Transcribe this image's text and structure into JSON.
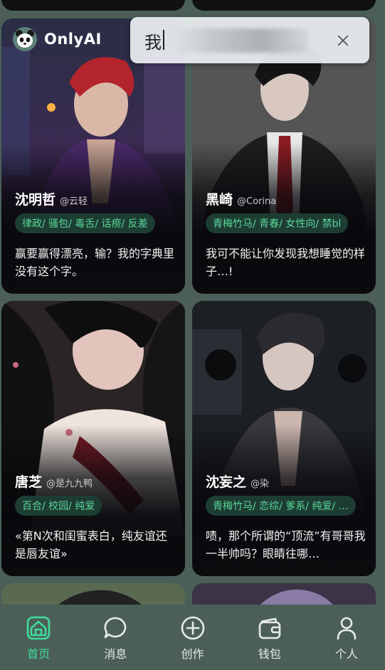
{
  "app": {
    "name": "OnlyAI",
    "logo_icon": "panda-icon"
  },
  "search": {
    "query": "我",
    "clear_icon": "close-icon"
  },
  "cards": [
    {
      "name": "沈明哲",
      "author": "@云轻",
      "tags": "律政/ 骚包/ 毒舌/ 话痨/ 反差",
      "desc": "赢要赢得漂亮，输？我的字典里没有这个字。"
    },
    {
      "name": "黑崎",
      "author": "@Corina",
      "tags": "青梅竹马/ 青春/ 女性向/ 禁bl",
      "desc": "我可不能让你发现我想睡觉的样子…!"
    },
    {
      "name": "唐芝",
      "author": "@是九九鸭",
      "tags": "百合/ 校园/ 纯爱",
      "desc": "«第N次和闺蜜表白，纯友谊还是唇友谊»"
    },
    {
      "name": "沈妄之",
      "author": "@染",
      "tags": "青梅竹马/ 恋综/ 爹系/ 纯爱/ …",
      "desc": "啧，那个所谓的“顶流”有哥哥我一半帅吗？眼睛往哪…"
    }
  ],
  "nav": [
    {
      "label": "首页",
      "icon": "home-icon",
      "active": true
    },
    {
      "label": "消息",
      "icon": "chat-bubble-icon",
      "active": false
    },
    {
      "label": "创作",
      "icon": "plus-circle-icon",
      "active": false
    },
    {
      "label": "钱包",
      "icon": "wallet-icon",
      "active": false
    },
    {
      "label": "个人",
      "icon": "person-icon",
      "active": false
    }
  ],
  "colors": {
    "accent": "#3fdc9a",
    "tag_bg": "#1d3d33",
    "tag_text": "#5bd69a",
    "nav_bg": "#4b5f58"
  }
}
